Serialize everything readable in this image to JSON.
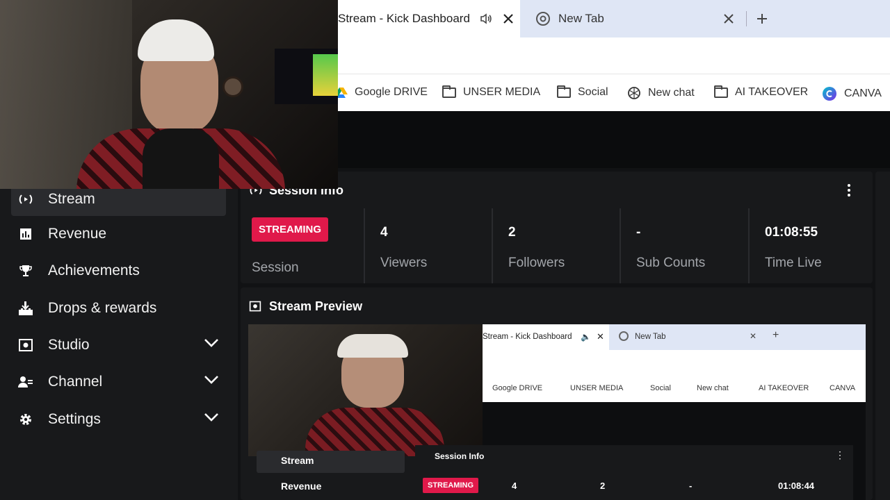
{
  "browser": {
    "tabs": [
      {
        "title": "Stream - Kick Dashboard",
        "active": true
      },
      {
        "title": "New Tab",
        "active": false
      }
    ],
    "bookmarks": [
      "Google DRIVE",
      "UNSER MEDIA",
      "Social",
      "New chat",
      "AI TAKEOVER",
      "CANVA"
    ]
  },
  "sidebar": {
    "items": [
      {
        "label": "Stream",
        "icon": "broadcast-icon",
        "active": true
      },
      {
        "label": "Revenue",
        "icon": "bar-chart-icon"
      },
      {
        "label": "Achievements",
        "icon": "trophy-icon"
      },
      {
        "label": "Drops & rewards",
        "icon": "drops-icon"
      },
      {
        "label": "Studio",
        "icon": "studio-icon",
        "expandable": true
      },
      {
        "label": "Channel",
        "icon": "channel-icon",
        "expandable": true
      },
      {
        "label": "Settings",
        "icon": "gear-icon",
        "expandable": true
      }
    ]
  },
  "session": {
    "title": "Session Info",
    "status_badge": "STREAMING",
    "status_label": "Session",
    "stats": [
      {
        "value": "4",
        "label": "Viewers"
      },
      {
        "value": "2",
        "label": "Followers"
      },
      {
        "value": "-",
        "label": "Sub Counts"
      },
      {
        "value": "01:08:55",
        "label": "Time Live"
      }
    ]
  },
  "preview": {
    "title": "Stream Preview",
    "inner": {
      "tabs": [
        "Stream - Kick Dashboard",
        "New Tab"
      ],
      "bookmarks": [
        "Google DRIVE",
        "UNSER MEDIA",
        "Social",
        "New chat",
        "AI TAKEOVER",
        "CANVA"
      ],
      "sidebar": [
        "Stream",
        "Revenue"
      ],
      "session_title": "Session Info",
      "badge": "STREAMING",
      "stats": [
        "4",
        "2",
        "-",
        "01:08:44"
      ]
    }
  },
  "colors": {
    "accent": "#e0194a",
    "panel": "#18191b",
    "background": "#111214"
  }
}
